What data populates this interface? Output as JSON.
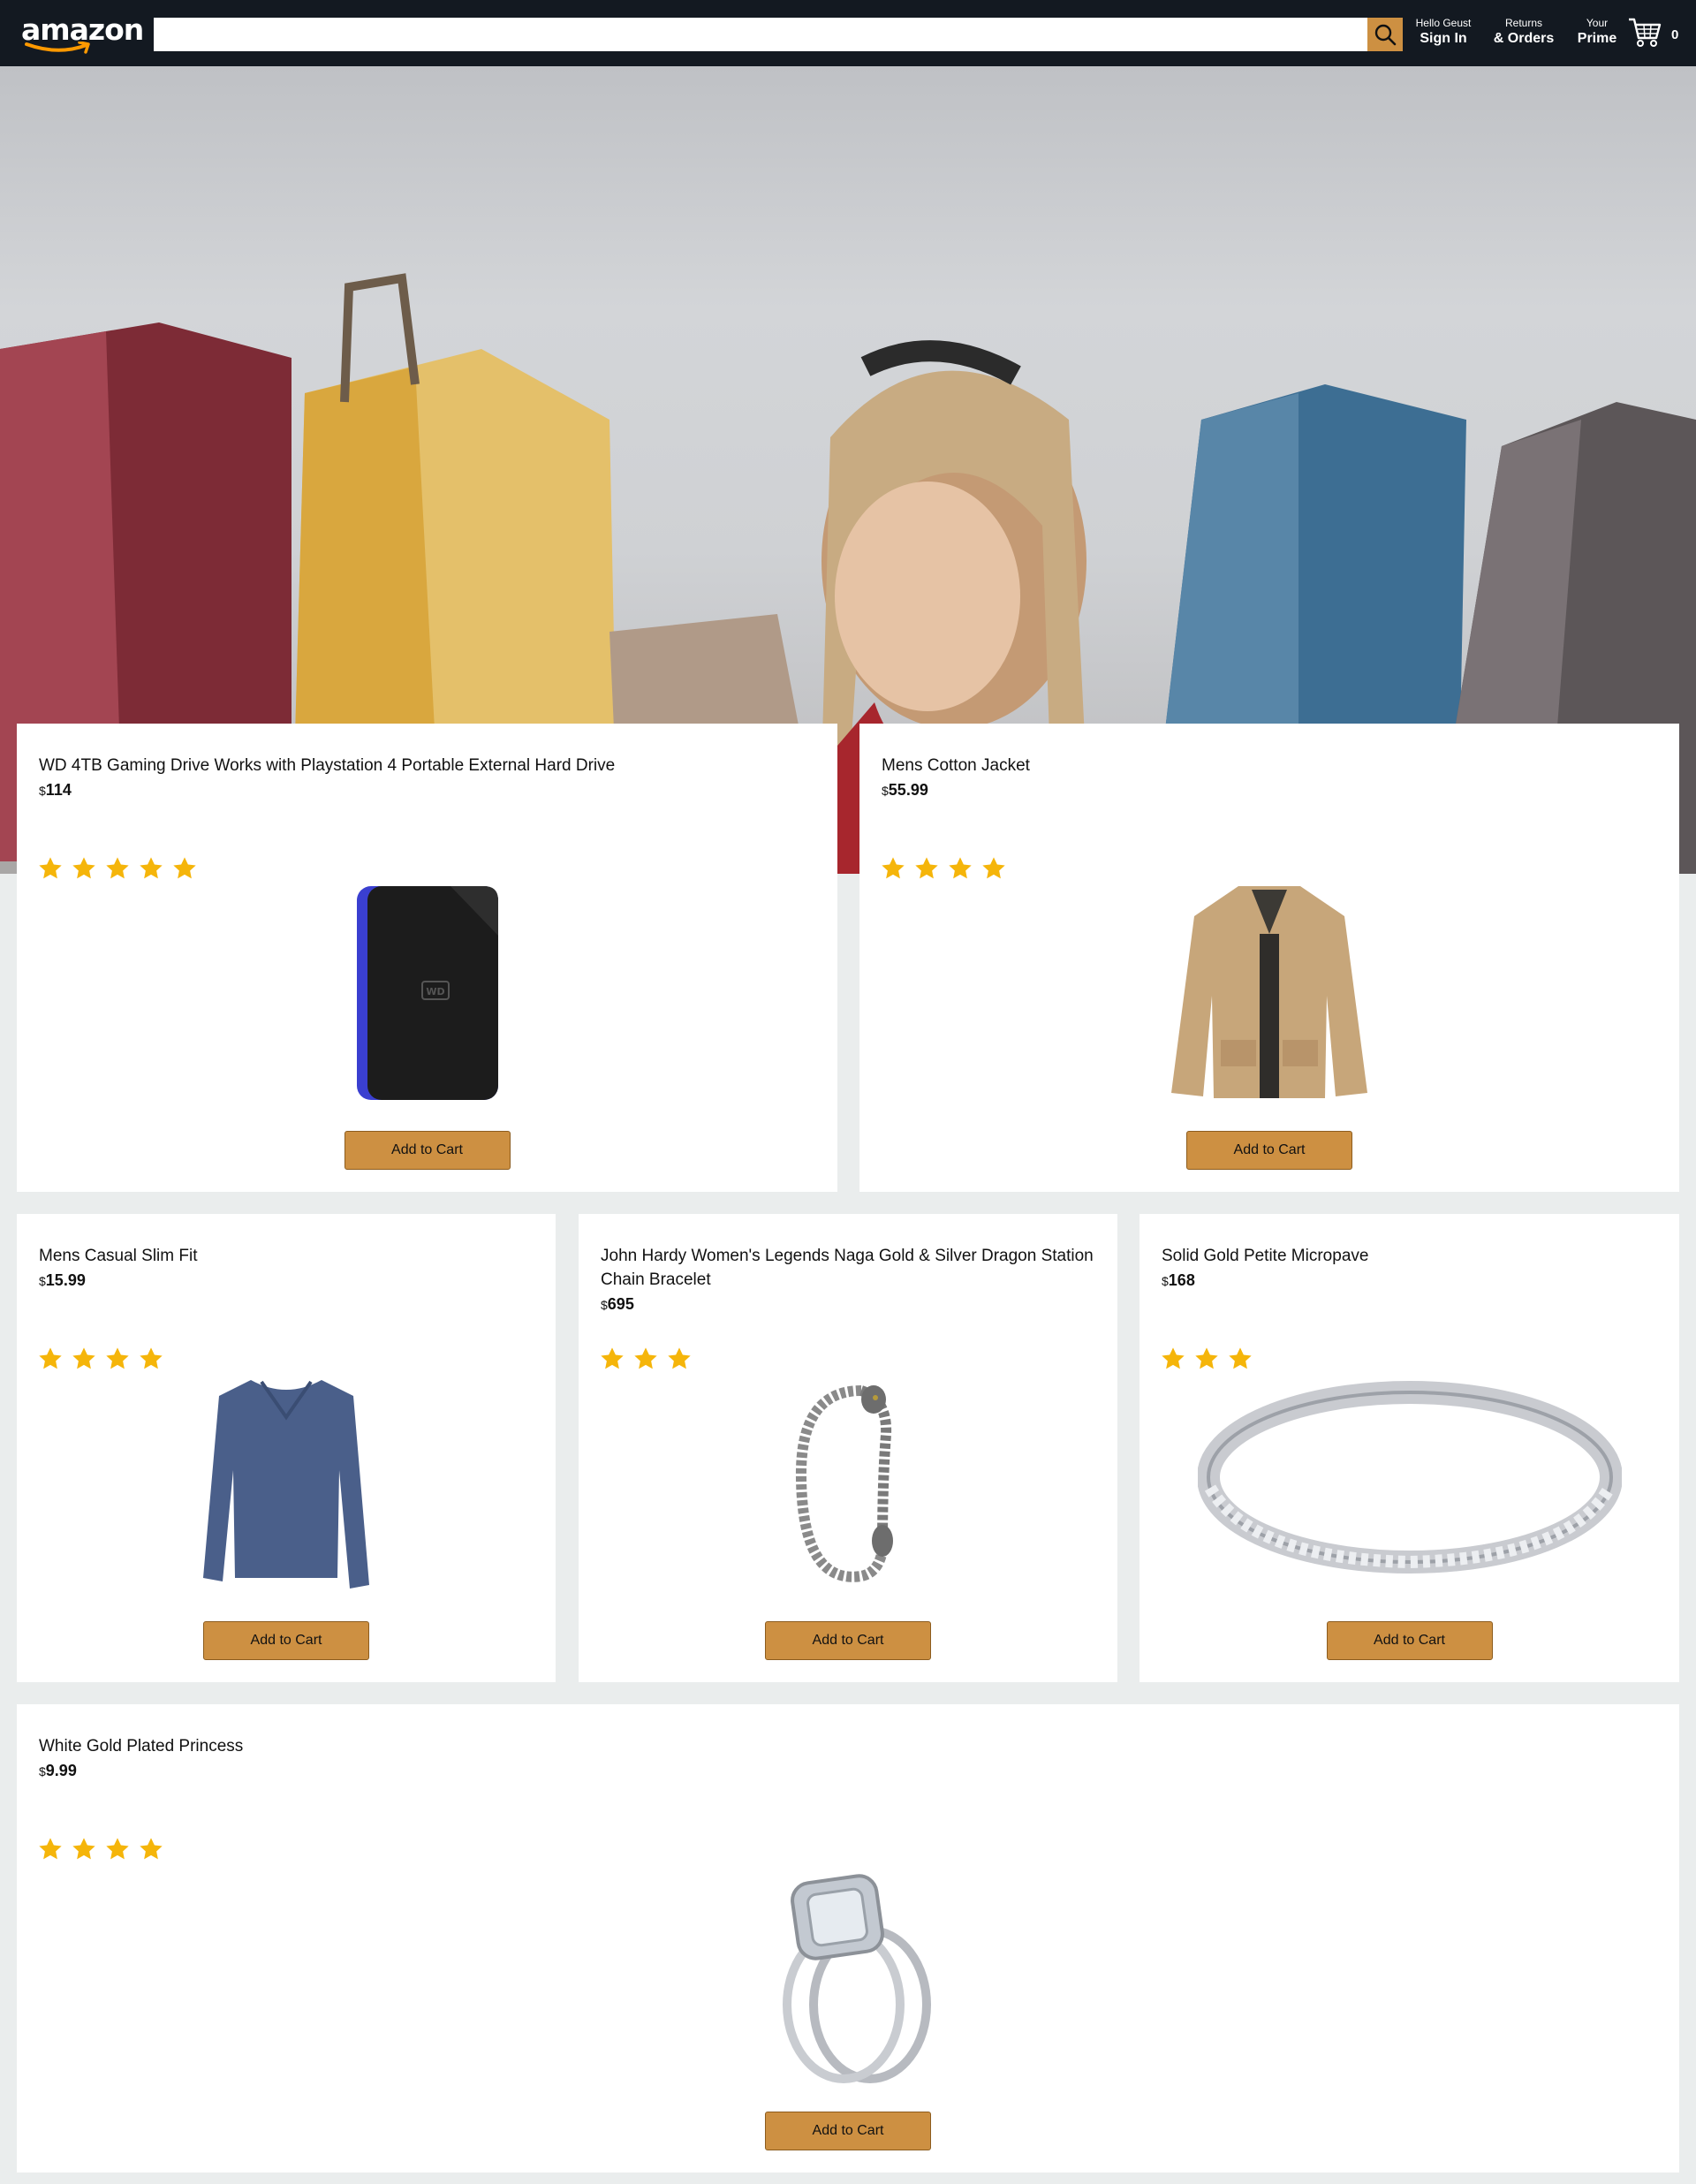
{
  "header": {
    "logo": "amazon",
    "search": {
      "value": "",
      "placeholder": ""
    },
    "nav": [
      {
        "line1": "Hello Geust",
        "line2": "Sign In"
      },
      {
        "line1": "Returns",
        "line2": "& Orders"
      },
      {
        "line1": "Your",
        "line2": "Prime"
      }
    ],
    "basket_count": "0"
  },
  "colors": {
    "header_bg": "#131921",
    "accent": "#cd9042",
    "star": "#f5b50a",
    "page_bg": "#eaeded"
  },
  "products": [
    {
      "title": "WD 4TB Gaming Drive Works with Playstation 4 Portable External Hard Drive",
      "currency": "$",
      "price": "114",
      "rating": 5,
      "image": "hard-drive-image",
      "button": "Add to Cart"
    },
    {
      "title": "Mens Cotton Jacket",
      "currency": "$",
      "price": "55.99",
      "rating": 4,
      "image": "jacket-image",
      "button": "Add to Cart"
    },
    {
      "title": "Mens Casual Slim Fit",
      "currency": "$",
      "price": "15.99",
      "rating": 4,
      "image": "shirt-image",
      "button": "Add to Cart"
    },
    {
      "title": "John Hardy Women's Legends Naga Gold & Silver Dragon Station Chain Bracelet",
      "currency": "$",
      "price": "695",
      "rating": 3,
      "image": "bracelet-image",
      "button": "Add to Cart"
    },
    {
      "title": "Solid Gold Petite Micropave",
      "currency": "$",
      "price": "168",
      "rating": 3,
      "image": "ring-band-image",
      "button": "Add to Cart"
    },
    {
      "title": "White Gold Plated Princess",
      "currency": "$",
      "price": "9.99",
      "rating": 4,
      "image": "diamond-ring-image",
      "button": "Add to Cart"
    }
  ]
}
